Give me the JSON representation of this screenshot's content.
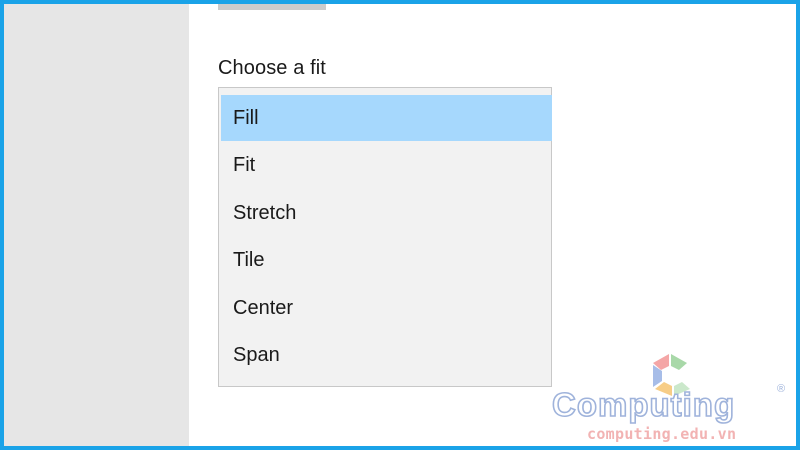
{
  "settings": {
    "label": "Choose a fit",
    "options": [
      "Fill",
      "Fit",
      "Stretch",
      "Tile",
      "Center",
      "Span"
    ],
    "selected": "Fill"
  },
  "watermark": {
    "brand": "Computing",
    "registered": "®",
    "url": "computing.edu.vn",
    "logo_colors": [
      "#f4a6a6",
      "#a8d8a8",
      "#f7cd87",
      "#a7bde8"
    ]
  },
  "colors": {
    "frame": "#1aa3e8",
    "sidebar": "#e6e6e6",
    "dropdown_bg": "#f2f2f2",
    "selected_bg": "#a6d8fd"
  }
}
